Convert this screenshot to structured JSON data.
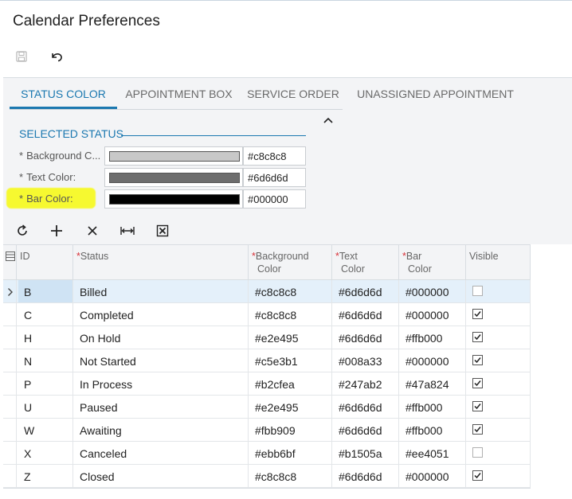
{
  "page": {
    "title": "Calendar Preferences"
  },
  "toolbar": {
    "save_icon": "save-icon",
    "undo_icon": "undo-icon"
  },
  "tabs": [
    {
      "label": "STATUS COLOR"
    },
    {
      "label": "APPOINTMENT BOX"
    },
    {
      "label": "SERVICE ORDER"
    },
    {
      "label": "UNASSIGNED APPOINTMENT"
    }
  ],
  "section": {
    "title": "SELECTED STATUS",
    "fields": [
      {
        "label": "Background C...",
        "hex": "#c8c8c8",
        "color": "#c8c8c8"
      },
      {
        "label": "Text Color:",
        "hex": "#6d6d6d",
        "color": "#6d6d6d"
      },
      {
        "label": "Bar Color:",
        "hex": "#000000",
        "color": "#000000"
      }
    ],
    "required_marker": "*"
  },
  "grid": {
    "columns": {
      "id": "ID",
      "status": "Status",
      "background": [
        "Background",
        "Color"
      ],
      "text": [
        "Text",
        "Color"
      ],
      "bar": [
        "Bar",
        "Color"
      ],
      "visible": "Visible"
    },
    "rows": [
      {
        "id": "B",
        "status": "Billed",
        "bg": "#c8c8c8",
        "text": "#6d6d6d",
        "bar": "#000000",
        "visible": false
      },
      {
        "id": "C",
        "status": "Completed",
        "bg": "#c8c8c8",
        "text": "#6d6d6d",
        "bar": "#000000",
        "visible": true
      },
      {
        "id": "H",
        "status": "On Hold",
        "bg": "#e2e495",
        "text": "#6d6d6d",
        "bar": "#ffb000",
        "visible": true
      },
      {
        "id": "N",
        "status": "Not Started",
        "bg": "#c5e3b1",
        "text": "#008a33",
        "bar": "#000000",
        "visible": true
      },
      {
        "id": "P",
        "status": "In Process",
        "bg": "#b2cfea",
        "text": "#247ab2",
        "bar": "#47a824",
        "visible": true
      },
      {
        "id": "U",
        "status": "Paused",
        "bg": "#e2e495",
        "text": "#6d6d6d",
        "bar": "#ffb000",
        "visible": true
      },
      {
        "id": "W",
        "status": "Awaiting",
        "bg": "#fbb909",
        "text": "#6d6d6d",
        "bar": "#ffb000",
        "visible": true
      },
      {
        "id": "X",
        "status": "Canceled",
        "bg": "#ebb6bf",
        "text": "#b1505a",
        "bar": "#ee4051",
        "visible": false
      },
      {
        "id": "Z",
        "status": "Closed",
        "bg": "#c8c8c8",
        "text": "#6d6d6d",
        "bar": "#000000",
        "visible": true
      }
    ]
  },
  "colors": {
    "accent": "#1b78b0",
    "highlight": "#f6f930",
    "required": "#d9333a"
  }
}
